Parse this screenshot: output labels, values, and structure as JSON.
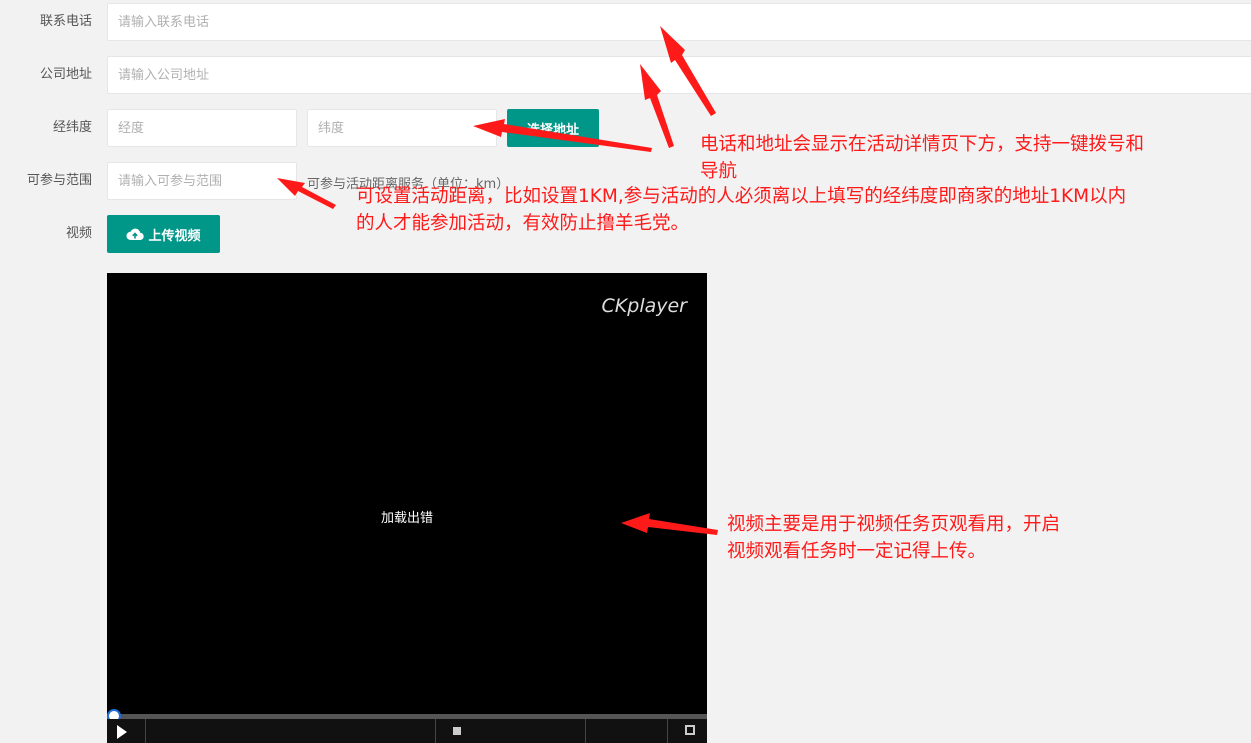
{
  "form": {
    "phone": {
      "label": "联系电话",
      "placeholder": "请输入联系电话"
    },
    "address": {
      "label": "公司地址",
      "placeholder": "请输入公司地址"
    },
    "coords": {
      "label": "经纬度",
      "longitude_placeholder": "经度",
      "latitude_placeholder": "纬度",
      "button": "选择地址"
    },
    "range": {
      "label": "可参与范围",
      "placeholder": "请输入可参与范围",
      "hint": "可参与活动距离服务（单位：km）"
    },
    "video": {
      "label": "视频",
      "button": "上传视频"
    }
  },
  "player": {
    "brand": "CKplayer",
    "error": "加载出错"
  },
  "annotations": {
    "phone_address_1": "电话和地址会显示在活动详情页下方，支持一键拨号和",
    "phone_address_2": "导航",
    "range_1": "可设置活动距离，比如设置1KM,参与活动的人必须离以上填写的经纬度即商家的地址1KM以内",
    "range_2": "的人才能参加活动，有效防止撸羊毛党。",
    "video_1": "视频主要是用于视频任务页观看用，开启",
    "video_2": "视频观看任务时一定记得上传。"
  },
  "colors": {
    "accent": "#009688",
    "annotation": "#ff1a1a"
  }
}
